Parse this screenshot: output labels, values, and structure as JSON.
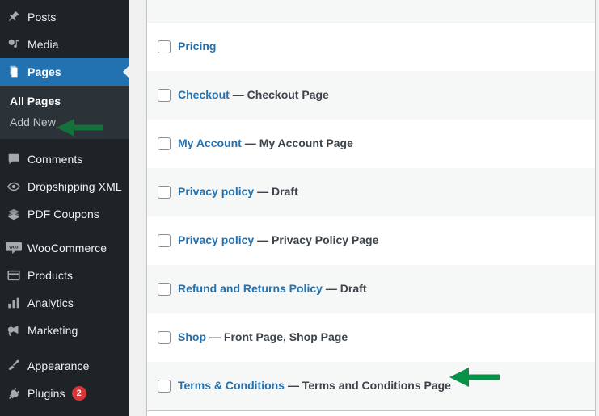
{
  "sidebar": {
    "items": [
      {
        "label": "Posts",
        "icon": "pushpin-icon",
        "name": "posts",
        "current": false
      },
      {
        "label": "Media",
        "icon": "media-icon",
        "name": "media",
        "current": false
      },
      {
        "label": "Pages",
        "icon": "pages-icon",
        "name": "pages",
        "current": true
      },
      {
        "label": "Comments",
        "icon": "comments-icon",
        "name": "comments",
        "current": false
      },
      {
        "label": "Dropshipping XML",
        "icon": "sync-eye-icon",
        "name": "dropshipping-xml",
        "current": false
      },
      {
        "label": "PDF Coupons",
        "icon": "tickets-icon",
        "name": "pdf-coupons",
        "current": false
      },
      {
        "label": "WooCommerce",
        "icon": "woo-icon",
        "name": "woocommerce",
        "current": false
      },
      {
        "label": "Products",
        "icon": "products-icon",
        "name": "products",
        "current": false
      },
      {
        "label": "Analytics",
        "icon": "analytics-bars-icon",
        "name": "analytics",
        "current": false
      },
      {
        "label": "Marketing",
        "icon": "megaphone-icon",
        "name": "marketing",
        "current": false
      },
      {
        "label": "Appearance",
        "icon": "paintbrush-icon",
        "name": "appearance",
        "current": false
      },
      {
        "label": "Plugins",
        "icon": "plug-icon",
        "name": "plugins",
        "current": false,
        "badge": "2"
      }
    ],
    "submenu": [
      {
        "label": "All Pages",
        "name": "all-pages",
        "current": true
      },
      {
        "label": "Add New",
        "name": "add-new",
        "current": false
      }
    ],
    "colors": {
      "background": "#1d2327",
      "submenu_background": "#2c3338",
      "current_background": "#2271b1",
      "badge_background": "#d63638"
    }
  },
  "pages_table": {
    "rows": [
      {
        "title": "Pricing",
        "suffix": "",
        "name": "pricing"
      },
      {
        "title": "Checkout",
        "suffix": "— Checkout Page",
        "name": "checkout"
      },
      {
        "title": "My Account",
        "suffix": "— My Account Page",
        "name": "my-account"
      },
      {
        "title": "Privacy policy",
        "suffix": "— Draft",
        "name": "privacy-policy-draft"
      },
      {
        "title": "Privacy policy",
        "suffix": "— Privacy Policy Page",
        "name": "privacy-policy-page"
      },
      {
        "title": "Refund and Returns Policy",
        "suffix": "— Draft",
        "name": "refund-and-returns-policy"
      },
      {
        "title": "Shop",
        "suffix": "— Front Page, Shop Page",
        "name": "shop"
      },
      {
        "title": "Terms & Conditions",
        "suffix": "— Terms and Conditions Page",
        "name": "terms-and-conditions"
      }
    ],
    "colors": {
      "link": "#2271b1",
      "suffix_text": "#3c434a",
      "alt_row": "#f6f7f7",
      "border": "#c3c4c7"
    }
  },
  "annotations": [
    {
      "name": "arrow-add-new",
      "color": "#14713c",
      "target": "Add New"
    },
    {
      "name": "arrow-terms-and-conditions",
      "color": "#079247",
      "target": "Terms & Conditions"
    }
  ]
}
